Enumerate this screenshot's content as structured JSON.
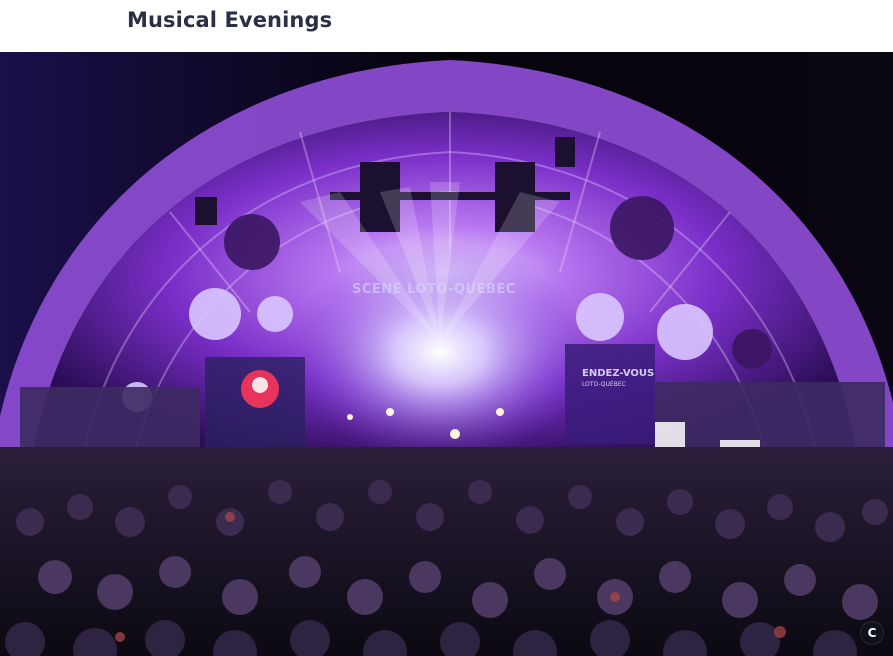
{
  "page": {
    "title": "Musical Evenings"
  },
  "photo": {
    "stage_sign": "SCENE LOTO-QUEBEC",
    "banner_main": "ENDEZ-VOUS",
    "banner_sub": "LOTO-QUÉBEC",
    "badge_label": "C"
  },
  "colors": {
    "title_text": "#2a2f45",
    "stage_purple": "#9b4fd8",
    "night_sky": "#07040f"
  }
}
